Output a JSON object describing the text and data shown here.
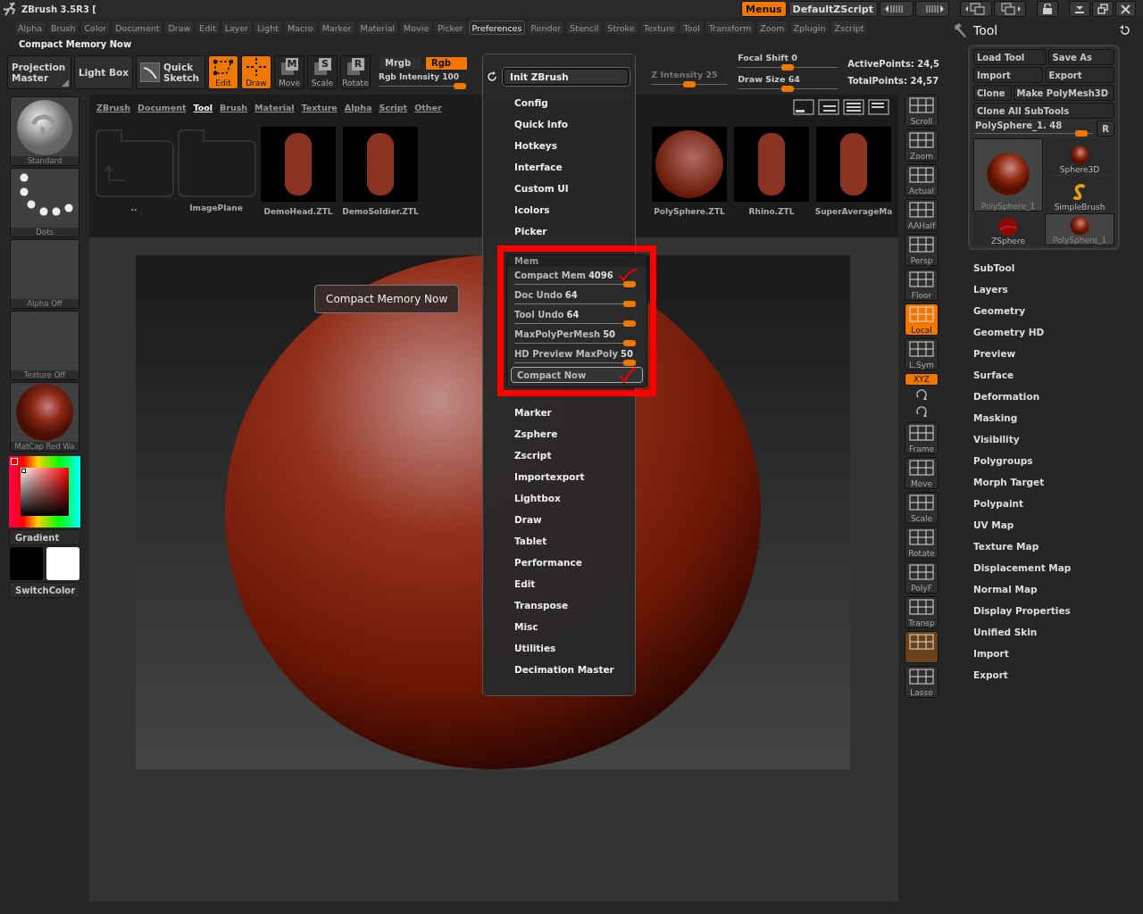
{
  "title_bar": {
    "title": "ZBrush 3.5R3 [",
    "menus_button": {
      "label": "Menus",
      "on": true
    },
    "script_button": "DefaultZScript"
  },
  "menu_bar": [
    {
      "label": "Alpha",
      "selected": false
    },
    {
      "label": "Brush",
      "selected": false
    },
    {
      "label": "Color",
      "selected": false
    },
    {
      "label": "Document",
      "selected": false
    },
    {
      "label": "Draw",
      "selected": false
    },
    {
      "label": "Edit",
      "selected": false
    },
    {
      "label": "Layer",
      "selected": false
    },
    {
      "label": "Light",
      "selected": false
    },
    {
      "label": "Macro",
      "selected": false
    },
    {
      "label": "Marker",
      "selected": false
    },
    {
      "label": "Material",
      "selected": false
    },
    {
      "label": "Movie",
      "selected": false
    },
    {
      "label": "Picker",
      "selected": false
    },
    {
      "label": "Preferences",
      "selected": true
    },
    {
      "label": "Render",
      "selected": false
    },
    {
      "label": "Stencil",
      "selected": false
    },
    {
      "label": "Stroke",
      "selected": false
    },
    {
      "label": "Texture",
      "selected": false
    },
    {
      "label": "Tool",
      "selected": false
    },
    {
      "label": "Transform",
      "selected": false
    },
    {
      "label": "Zoom",
      "selected": false
    },
    {
      "label": "Zplugin",
      "selected": false
    },
    {
      "label": "Zscript",
      "selected": false
    }
  ],
  "shelf_label": "Compact Memory Now",
  "toolbar": {
    "mode_buttons": [
      {
        "label": "Projection Master",
        "kind": "corner"
      },
      {
        "label": "Light Box",
        "kind": "plain"
      },
      {
        "label": "Quick Sketch",
        "kind": "sketch"
      }
    ],
    "tool_buttons": [
      {
        "label": "Edit",
        "kind": "edit",
        "selected": true
      },
      {
        "label": "Draw",
        "kind": "draw",
        "selected": true
      },
      {
        "label": "Move",
        "kind": "cube",
        "glyph": "M",
        "selected": false
      },
      {
        "label": "Scale",
        "kind": "cube",
        "glyph": "S",
        "selected": false
      },
      {
        "label": "Rotate",
        "kind": "cube",
        "glyph": "R",
        "selected": false
      }
    ],
    "color_modes": [
      {
        "label": "Mrgb",
        "selected": false
      },
      {
        "label": "Rgb",
        "selected": true
      }
    ],
    "rgb_intensity": {
      "label": "Rgb Intensity",
      "value": "100",
      "level": 1
    },
    "z_intensity": {
      "label": "Z Intensity",
      "value": "25",
      "level": 0.5
    },
    "draw_sliders": [
      {
        "label": "Focal Shift",
        "value": "0",
        "level": 0.5
      },
      {
        "label": "Draw Size",
        "value": "64",
        "level": 0.5
      }
    ],
    "stats": [
      "ActivePoints: 24,5",
      "TotalPoints: 24,57"
    ]
  },
  "left_shelf": {
    "brush": "Standard",
    "stroke": "Dots",
    "alpha": "Alpha Off",
    "texture": "Texture Off",
    "material": "MatCap Red Wa",
    "gradient": "Gradient",
    "switch_color": "SwitchColor"
  },
  "lightbox": {
    "tabs": [
      {
        "label": "ZBrush",
        "selected": false
      },
      {
        "label": "Document",
        "selected": false
      },
      {
        "label": "Tool",
        "selected": true
      },
      {
        "label": "Brush",
        "selected": false
      },
      {
        "label": "Material",
        "selected": false
      },
      {
        "label": "Texture",
        "selected": false
      },
      {
        "label": "Alpha",
        "selected": false
      },
      {
        "label": "Script",
        "selected": false
      },
      {
        "label": "Other",
        "selected": false
      }
    ],
    "items": [
      {
        "label": "..",
        "kind": "up"
      },
      {
        "label": "ImagePlane",
        "kind": "folder"
      },
      {
        "label": "DemoHead.ZTL",
        "kind": "model"
      },
      {
        "label": "DemoSoldier.ZTL",
        "kind": "model"
      },
      {
        "label": "PolySphere.ZTL",
        "kind": "sphere"
      },
      {
        "label": "Rhino.ZTL",
        "kind": "model"
      },
      {
        "label": "SuperAverageMa",
        "kind": "model"
      }
    ]
  },
  "canvas": {
    "tooltip": "Compact Memory Now"
  },
  "preferences_menu": {
    "init_button": "Init ZBrush",
    "items": [
      {
        "kind": "item",
        "label": "Config"
      },
      {
        "kind": "item",
        "label": "Quick Info"
      },
      {
        "kind": "item",
        "label": "Hotkeys"
      },
      {
        "kind": "item",
        "label": "Interface"
      },
      {
        "kind": "item",
        "label": "Custom UI"
      },
      {
        "kind": "item",
        "label": "Icolors"
      },
      {
        "kind": "item",
        "label": "Picker"
      },
      {
        "kind": "section",
        "label": "Mem",
        "sliders": [
          {
            "label": "Compact Mem",
            "value": "4096",
            "level": 1,
            "ticked": true
          },
          {
            "label": "Doc Undo",
            "value": "64",
            "level": 1,
            "ticked": false
          },
          {
            "label": "Tool Undo",
            "value": "64",
            "level": 1,
            "ticked": false
          },
          {
            "label": "MaxPolyPerMesh",
            "value": "50",
            "level": 1,
            "ticked": false
          },
          {
            "label": "HD Preview MaxPoly",
            "value": "50",
            "level": 1,
            "ticked": false
          }
        ],
        "button": "Compact Now"
      },
      {
        "kind": "item",
        "label": "Marker"
      },
      {
        "kind": "item",
        "label": "Zsphere"
      },
      {
        "kind": "item",
        "label": "Zscript"
      },
      {
        "kind": "item",
        "label": "Importexport"
      },
      {
        "kind": "item",
        "label": "Lightbox"
      },
      {
        "kind": "item",
        "label": "Draw"
      },
      {
        "kind": "item",
        "label": "Tablet"
      },
      {
        "kind": "item",
        "label": "Performance"
      },
      {
        "kind": "item",
        "label": "Edit"
      },
      {
        "kind": "item",
        "label": "Transpose"
      },
      {
        "kind": "item",
        "label": "Misc"
      },
      {
        "kind": "item",
        "label": "Utilities"
      },
      {
        "kind": "item",
        "label": "Decimation Master"
      }
    ]
  },
  "right_shelf": [
    {
      "label": "Scroll",
      "kind": "large",
      "on": false
    },
    {
      "label": "Zoom",
      "kind": "large",
      "on": false
    },
    {
      "label": "Actual",
      "kind": "large",
      "on": false
    },
    {
      "label": "AAHalf",
      "kind": "large",
      "on": false
    },
    {
      "label": "Persp",
      "kind": "large",
      "on": false
    },
    {
      "label": "Floor",
      "kind": "large",
      "on": false
    },
    {
      "label": "Local",
      "kind": "large",
      "on": true
    },
    {
      "label": "L.Sym",
      "kind": "large",
      "on": false
    },
    {
      "label": "XYZ",
      "kind": "toggle",
      "on": true
    },
    {
      "kind": "small",
      "on": false
    },
    {
      "kind": "small",
      "on": false
    },
    {
      "label": "Frame",
      "kind": "large",
      "on": false
    },
    {
      "label": "Move",
      "kind": "large",
      "on": false
    },
    {
      "label": "Scale",
      "kind": "large",
      "on": false
    },
    {
      "label": "Rotate",
      "kind": "large",
      "on": false
    },
    {
      "label": "PolyF",
      "kind": "large",
      "on": false
    },
    {
      "label": "Transp",
      "kind": "large",
      "on": false
    },
    {
      "kind": "dim",
      "on": true
    },
    {
      "label": "Lasso",
      "kind": "large",
      "on": false
    }
  ],
  "tool_palette": {
    "title": "Tool",
    "button_rows": [
      [
        "Load Tool",
        "Save As"
      ],
      [
        "Import",
        "Export"
      ],
      [
        "Clone",
        "Make PolyMesh3D"
      ],
      [
        "Clone All SubTools"
      ]
    ],
    "slider": {
      "label": "PolySphere_1. 48",
      "level": 0.95
    },
    "reset_button": "R",
    "tools": [
      {
        "label": "Sphere3D",
        "kind": "sphere",
        "selected": false
      },
      {
        "label": "PolySphere_1",
        "kind": "sphere",
        "selected": true
      },
      {
        "label": "SimpleBrush",
        "kind": "brush",
        "selected": false
      },
      {
        "label": "ZSphere",
        "kind": "zsphere",
        "selected": false
      },
      {
        "label": "PolySphere_1",
        "kind": "sphere",
        "selected": true
      }
    ],
    "subpalettes": [
      "SubTool",
      "Layers",
      "Geometry",
      "Geometry HD",
      "Preview",
      "Surface",
      "Deformation",
      "Masking",
      "Visibility",
      "Polygroups",
      "Morph Target",
      "Polypaint",
      "UV Map",
      "Texture Map",
      "Displacement Map",
      "Normal Map",
      "Display Properties",
      "Unified Skin",
      "Import",
      "Export"
    ]
  }
}
